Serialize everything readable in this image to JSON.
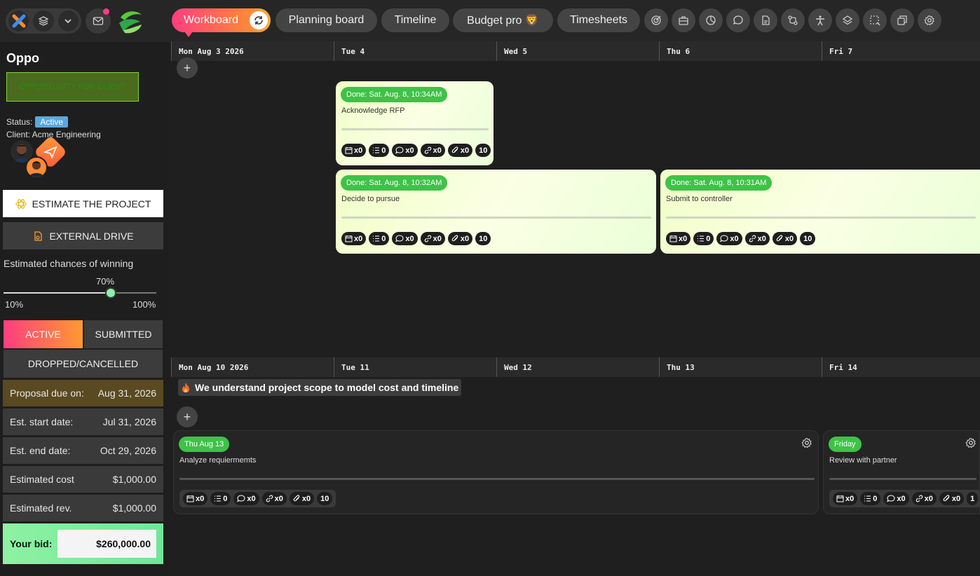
{
  "topbar": {
    "tabs": [
      {
        "label": "Workboard"
      },
      {
        "label": "Planning board"
      },
      {
        "label": "Timeline"
      },
      {
        "label": "Budget pro 🦁"
      },
      {
        "label": "Timesheets"
      }
    ],
    "icons": [
      "target-icon",
      "briefcase-icon",
      "pie-chart-icon",
      "chat-icon",
      "file-icon",
      "compare-icon",
      "accessibility-icon",
      "layers-icon",
      "select-icon",
      "copy-icon",
      "settings-icon"
    ]
  },
  "sidebar": {
    "project_name": "Oppo",
    "type_badge": "OPPORTUNITY FOR CLIENT",
    "status_label": "Status:",
    "status_value": "Active",
    "client": "Client: Acme Engineering",
    "estimate_btn": "ESTIMATE THE PROJECT",
    "drive_btn": "EXTERNAL DRIVE",
    "chances_label": "Estimated chances of winning",
    "chances_value": "70%",
    "chances_fraction": 0.7,
    "chances_min": "10%",
    "chances_max": "100%",
    "states": [
      "ACTIVE",
      "SUBMITTED",
      "DROPPED/CANCELLED"
    ],
    "rows": [
      {
        "label": "Proposal due on:",
        "value": "Aug 31, 2026"
      },
      {
        "label": "Est. start date:",
        "value": "Jul 31, 2026"
      },
      {
        "label": "Est. end date:",
        "value": "Oct 29, 2026"
      },
      {
        "label": "Estimated cost",
        "value": "$1,000.00"
      },
      {
        "label": "Estimated rev.",
        "value": "$1,000.00"
      }
    ],
    "bid_label": "Your bid:",
    "bid_value": "$260,000.00"
  },
  "week1": {
    "days": [
      "Mon Aug 3 2026",
      "Tue 4",
      "Wed 5",
      "Thu 6",
      "Fri 7"
    ],
    "cards": [
      {
        "done": "Done: Sat. Aug. 8, 10:34AM",
        "title": "Acknowledge RFP",
        "chips": [
          "x0",
          "0",
          "x0",
          "x0",
          "x0",
          "10"
        ]
      },
      {
        "done": "Done: Sat. Aug. 8, 10:32AM",
        "title": "Decide to pursue",
        "chips": [
          "x0",
          "0",
          "x0",
          "x0",
          "x0",
          "10"
        ]
      },
      {
        "done": "Done: Sat. Aug. 8, 10:31AM",
        "title": "Submit to controller",
        "chips": [
          "x0",
          "0",
          "x0",
          "x0",
          "x0",
          "10"
        ]
      }
    ]
  },
  "week2": {
    "days": [
      "Mon Aug 10 2026",
      "Tue 11",
      "Wed 12",
      "Thu 13",
      "Fri 14"
    ],
    "milestone": "We understand project scope to model cost and timeline",
    "cards": [
      {
        "date": "Thu Aug 13",
        "title": "Analyze requiermemts",
        "chips": [
          "x0",
          "0",
          "x0",
          "x0",
          "x0",
          "10"
        ]
      },
      {
        "date": "Friday",
        "title": "Review with partner",
        "chips": [
          "x0",
          "0",
          "x0",
          "x0",
          "x0",
          "1"
        ]
      }
    ]
  }
}
